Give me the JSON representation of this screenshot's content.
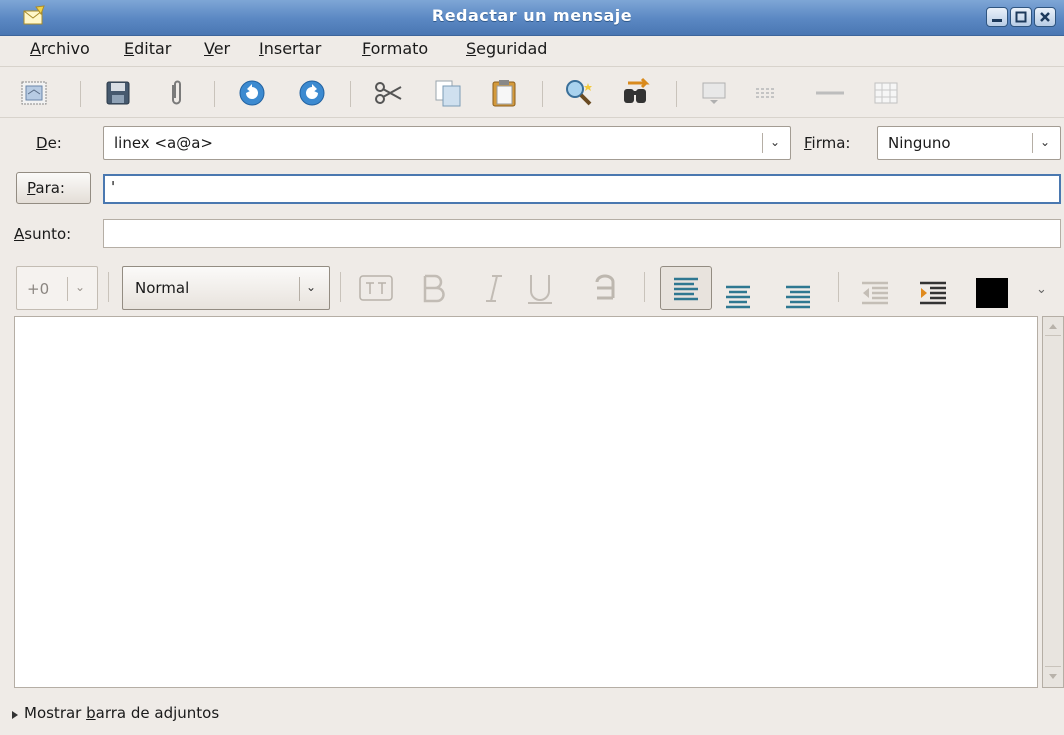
{
  "window": {
    "title": "Redactar un mensaje"
  },
  "menubar": {
    "items": [
      {
        "label": "Archivo",
        "mnemonic": "A",
        "rest": "rchivo"
      },
      {
        "label": "Editar",
        "mnemonic": "E",
        "rest": "ditar"
      },
      {
        "label": "Ver",
        "mnemonic": "V",
        "rest": "er"
      },
      {
        "label": "Insertar",
        "mnemonic": "I",
        "rest": "nsertar"
      },
      {
        "label": "Formato",
        "mnemonic": "F",
        "rest": "ormato"
      },
      {
        "label": "Seguridad",
        "mnemonic": "S",
        "rest": "eguridad"
      }
    ]
  },
  "toolbar": {
    "icons": [
      "send-icon",
      "save-icon",
      "attach-icon",
      "undo-icon",
      "redo-icon",
      "cut-icon",
      "copy-icon",
      "paste-icon",
      "find-icon",
      "find-replace-icon",
      "insert-image-icon",
      "insert-link-icon",
      "horizontal-rule-icon",
      "insert-table-icon"
    ]
  },
  "header": {
    "from_mnemonic": "D",
    "from_rest": "e:",
    "from_value": "linex <a@a>",
    "signature_mnemonic": "F",
    "signature_rest": "irma:",
    "signature_value": "Ninguno",
    "to_mnemonic": "P",
    "to_rest": "ara:",
    "to_value": "'",
    "subject_mnemonic": "A",
    "subject_rest": "sunto:",
    "subject_value": ""
  },
  "format": {
    "font_size_value": "+0",
    "paragraph_style_value": "Normal",
    "text_color": "#000000"
  },
  "footer": {
    "attach_prefix": "Mostrar ",
    "attach_mnemonic": "b",
    "attach_rest": "arra de adjuntos"
  },
  "colors": {
    "titlebar": "#5a87c2",
    "focus": "#4a78b0"
  }
}
